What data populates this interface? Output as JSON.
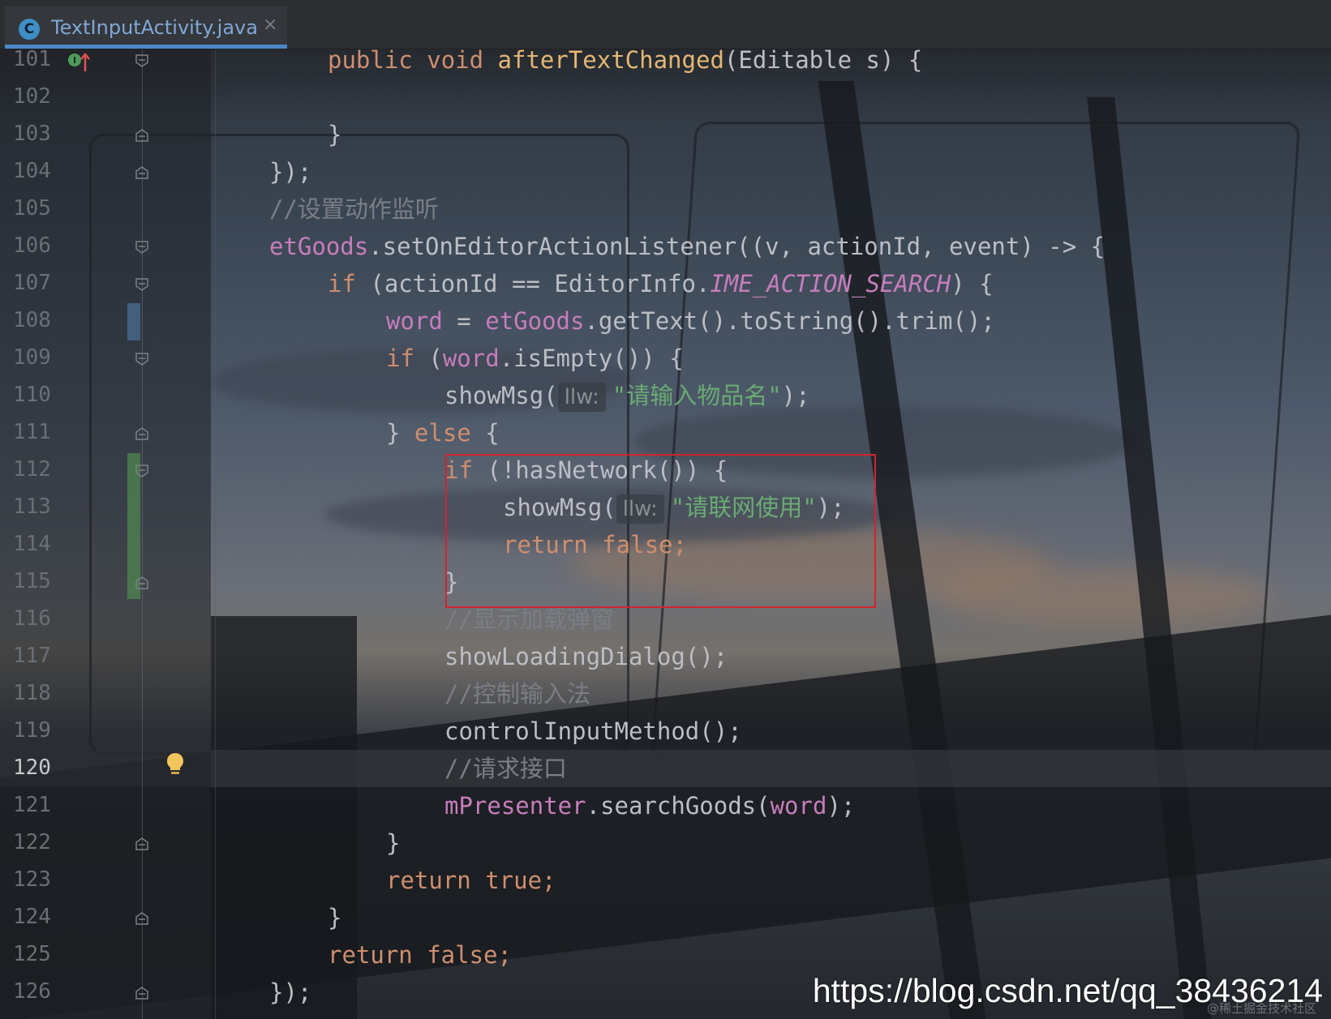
{
  "tab": {
    "icon_letter": "C",
    "title": "TextInputActivity.java",
    "close_glyph": "×"
  },
  "line_numbers": [
    "101",
    "102",
    "103",
    "104",
    "105",
    "106",
    "107",
    "108",
    "109",
    "110",
    "111",
    "112",
    "113",
    "114",
    "115",
    "116",
    "117",
    "118",
    "119",
    "120",
    "121",
    "122",
    "123",
    "124",
    "125",
    "126"
  ],
  "current_line": "120",
  "code": {
    "l101": {
      "kw1": "public",
      "kw2": "void",
      "fn": "afterTextChanged",
      "rest": "(Editable s) {"
    },
    "l103": {
      "text": "}"
    },
    "l104": {
      "text": "});"
    },
    "l105": {
      "comment": "//设置动作监听"
    },
    "l106": {
      "field": "etGoods",
      "rest": ".setOnEditorActionListener((v, actionId, event) -> {"
    },
    "l107": {
      "kw": "if",
      "pre": " (actionId == EditorInfo.",
      "const": "IME_ACTION_SEARCH",
      "post": ") {"
    },
    "l108": {
      "field": "word",
      "mid": " = ",
      "field2": "etGoods",
      "rest": ".getText().toString().trim();"
    },
    "l109": {
      "kw": "if",
      "pre": " (",
      "field": "word",
      "rest": ".isEmpty()) {"
    },
    "l110": {
      "call": "showMsg(",
      "hint": "llw:",
      "str": "\"请输入物品名\"",
      "end": ");"
    },
    "l111": {
      "pre": "} ",
      "kw": "else",
      "post": " {"
    },
    "l112": {
      "kw": "if",
      "rest": " (!hasNetwork()) {"
    },
    "l113": {
      "call": "showMsg(",
      "hint": "llw:",
      "str": "\"请联网使用\"",
      "end": ");"
    },
    "l114": {
      "kw": "return false;"
    },
    "l115": {
      "text": "}"
    },
    "l116": {
      "comment": "//显示加载弹窗"
    },
    "l117": {
      "text": "showLoadingDialog();"
    },
    "l118": {
      "comment": "//控制输入法"
    },
    "l119": {
      "text": "controlInputMethod();"
    },
    "l120": {
      "comment": "//请求接口"
    },
    "l121": {
      "field": "mPresenter",
      "mid": ".searchGoods(",
      "field2": "word",
      "end": ");"
    },
    "l122": {
      "text": "}"
    },
    "l123": {
      "kw": "return true;"
    },
    "l124": {
      "text": "}"
    },
    "l125": {
      "kw": "return false;"
    },
    "l126": {
      "text": "});"
    }
  },
  "watermark": {
    "url": "https://blog.csdn.net/qq_38436214",
    "site": "@稀土掘金技术社区"
  },
  "colors": {
    "keyword": "#cf8e6d",
    "function": "#e6b673",
    "field": "#c77dbb",
    "string": "#6aab73",
    "comment": "#7a7e85",
    "highlight_box": "#d1242f",
    "tab_underline": "#4a88c7"
  },
  "icons": [
    "java-class-icon",
    "close-icon",
    "implements-marker-icon",
    "fold-icon",
    "intention-bulb-icon"
  ]
}
